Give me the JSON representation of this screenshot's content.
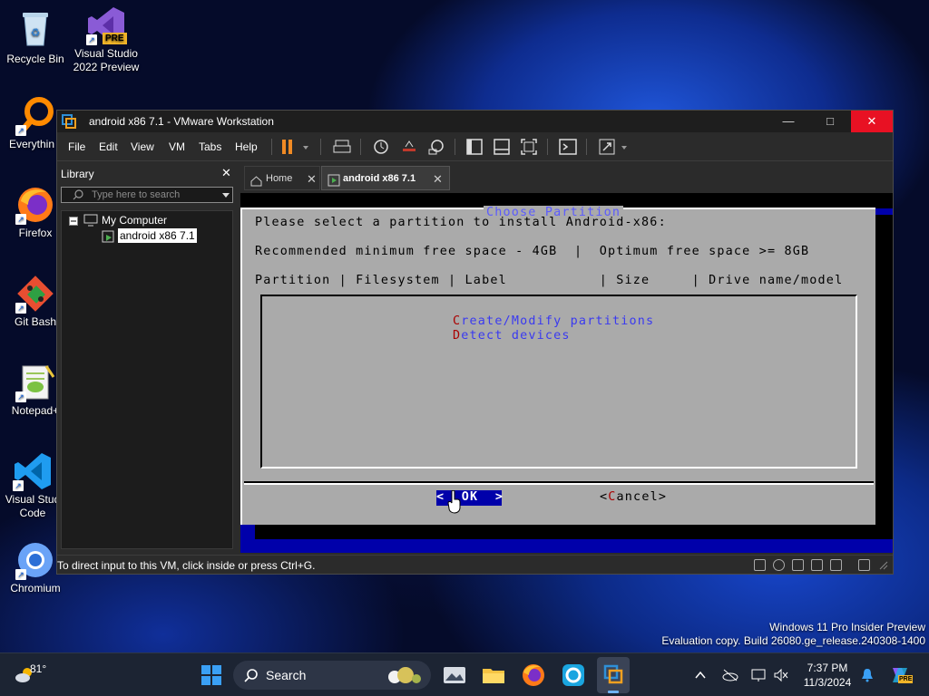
{
  "desktop": {
    "icons": [
      {
        "label": "Recycle Bin"
      },
      {
        "label": "Visual Studio 2022 Preview",
        "badge": "PRE"
      },
      {
        "label": "Everythin"
      },
      {
        "label": "Firefox"
      },
      {
        "label": "Git Bash"
      },
      {
        "label": "Notepad+"
      },
      {
        "label": "Visual Stud Code"
      },
      {
        "label": "Chromium"
      }
    ],
    "watermark": {
      "line1": "Windows 11 Pro Insider Preview",
      "line2": "Evaluation copy. Build 26080.ge_release.240308-1400"
    }
  },
  "vmware": {
    "title": "android x86 7.1 - VMware Workstation",
    "menu": [
      "File",
      "Edit",
      "View",
      "VM",
      "Tabs",
      "Help"
    ],
    "library": {
      "header": "Library",
      "search_placeholder": "Type here to search",
      "tree": {
        "root": "My Computer",
        "child": "android x86 7.1"
      }
    },
    "tabs": [
      {
        "label": "Home"
      },
      {
        "label": "android x86 7.1",
        "active": true
      }
    ],
    "status_text": "To direct input to this VM, click inside or press Ctrl+G.",
    "console": {
      "dialog_title": "Choose Partition",
      "line1": "Please select a partition to install Android-x86:",
      "line2": "Recommended minimum free space - 4GB  |  Optimum free space >= 8GB",
      "header": "Partition | Filesystem | Label           | Size     | Drive name/model",
      "options": [
        {
          "hotkey": "C",
          "rest": "reate/Modify partitions"
        },
        {
          "hotkey": "D",
          "rest": "etect devices"
        }
      ],
      "ok_button": "<  OK  >",
      "cancel_hotkey": "C",
      "cancel_prefix": "<",
      "cancel_rest": "ancel>"
    }
  },
  "taskbar": {
    "weather_temp": "81°",
    "search_label": "Search",
    "time": "7:37 PM",
    "date": "11/3/2024",
    "copilot_badge": "PRE"
  }
}
